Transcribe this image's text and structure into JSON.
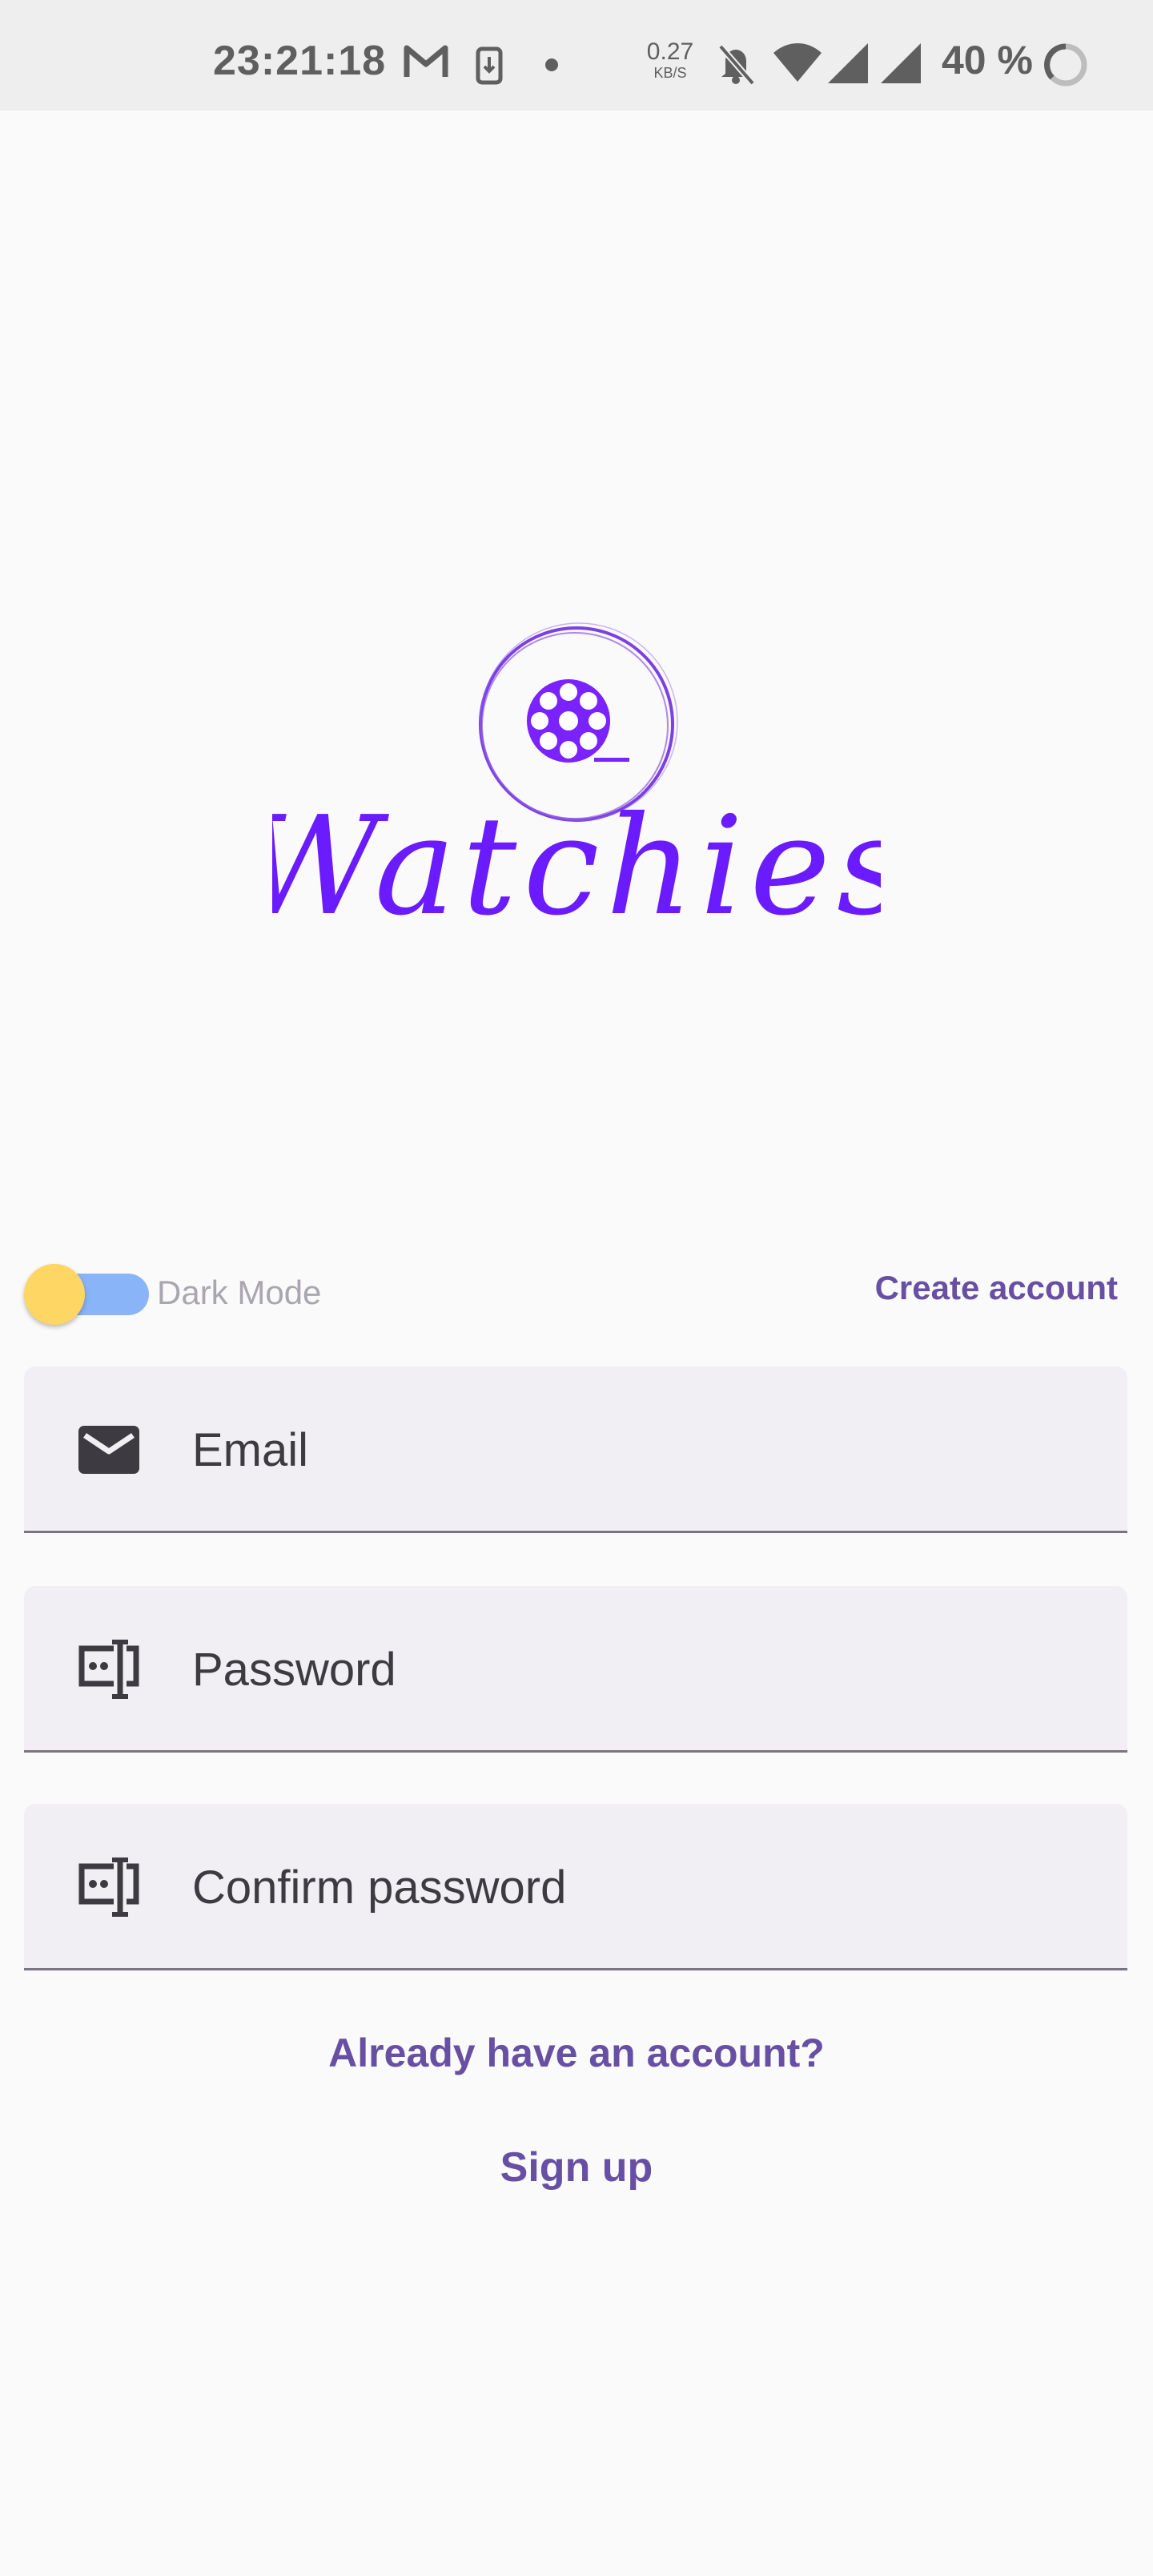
{
  "status_bar": {
    "time": "23:21:18",
    "net_speed_value": "0.27",
    "net_speed_unit": "KB/S",
    "battery_text": "40 %",
    "icons": [
      "gmail-icon",
      "download-icon",
      "dot-icon",
      "bell-off-icon",
      "wifi-icon",
      "signal-icon",
      "signal-icon-2",
      "battery-ring-icon"
    ]
  },
  "logo": {
    "wordmark": "Watchies",
    "icon": "film-reel-icon",
    "color": "#6a1bff"
  },
  "dark_mode": {
    "label": "Dark Mode",
    "enabled": false
  },
  "create_account_label": "Create account",
  "form": {
    "email": {
      "placeholder": "Email",
      "value": "",
      "icon": "mail-icon"
    },
    "password": {
      "placeholder": "Password",
      "value": "",
      "icon": "password-icon"
    },
    "confirm_password": {
      "placeholder": "Confirm password",
      "value": "",
      "icon": "password-icon"
    }
  },
  "already_account_label": "Already have an account?",
  "sign_up_label": "Sign up",
  "colors": {
    "accent": "#6750a4",
    "toggle_track": "#8ab4f8",
    "toggle_thumb": "#fdd663",
    "field_bg": "#f1eff4"
  }
}
